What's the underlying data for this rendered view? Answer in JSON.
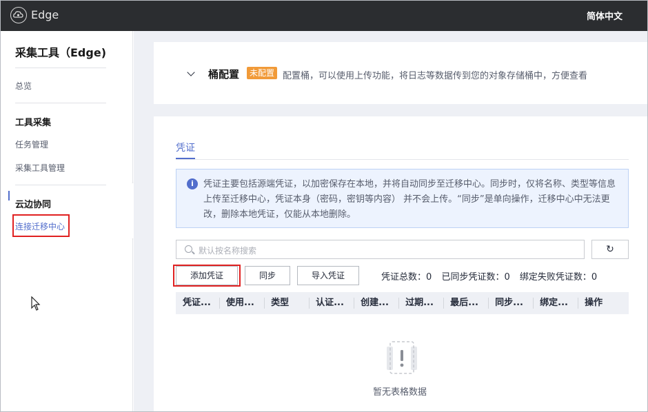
{
  "topbar": {
    "brand": "Edge",
    "language": "简体中文"
  },
  "sidebar": {
    "title": "采集工具（Edge)",
    "overview": "总览",
    "groups": [
      {
        "title": "工具采集",
        "items": [
          "任务管理",
          "采集工具管理"
        ]
      },
      {
        "title": "云边协同",
        "items": [
          "连接迁移中心"
        ]
      }
    ],
    "active_item": "连接迁移中心"
  },
  "bucket": {
    "title": "桶配置",
    "badge": "未配置",
    "description": "配置桶，可以使用上传功能，将日志等数据传到您的对象存储桶中，方便查看"
  },
  "tabs": [
    "凭证"
  ],
  "info_text": "凭证主要包括源端凭证，以加密保存在本地，并将自动同步至迁移中心。同步时，仅将名称、类型等信息上传至迁移中心，凭证本身（密码，密钥等内容） 并不会上传。“同步”是单向操作，迁移中心中无法更改，删除本地凭证，仅能从本地删除。",
  "search": {
    "placeholder": "默认按名称搜索"
  },
  "toolbar": {
    "add": "添加凭证",
    "sync": "同步",
    "import": "导入凭证"
  },
  "stats": {
    "total_label": "凭证总数：",
    "total": "0",
    "synced_label": "已同步凭证数：",
    "synced": "0",
    "failed_label": "绑定失败凭证数：",
    "failed": "0"
  },
  "table": {
    "columns": [
      "凭证...",
      "使用...",
      "类型",
      "认证...",
      "创建...",
      "过期...",
      "最后...",
      "同步...",
      "绑定...",
      "操作"
    ]
  },
  "empty": "暂无表格数据",
  "colors": {
    "accent": "#526ecc",
    "badge": "#f19a38",
    "highlight_box": "#e02020",
    "topbar": "#2b2d30"
  }
}
